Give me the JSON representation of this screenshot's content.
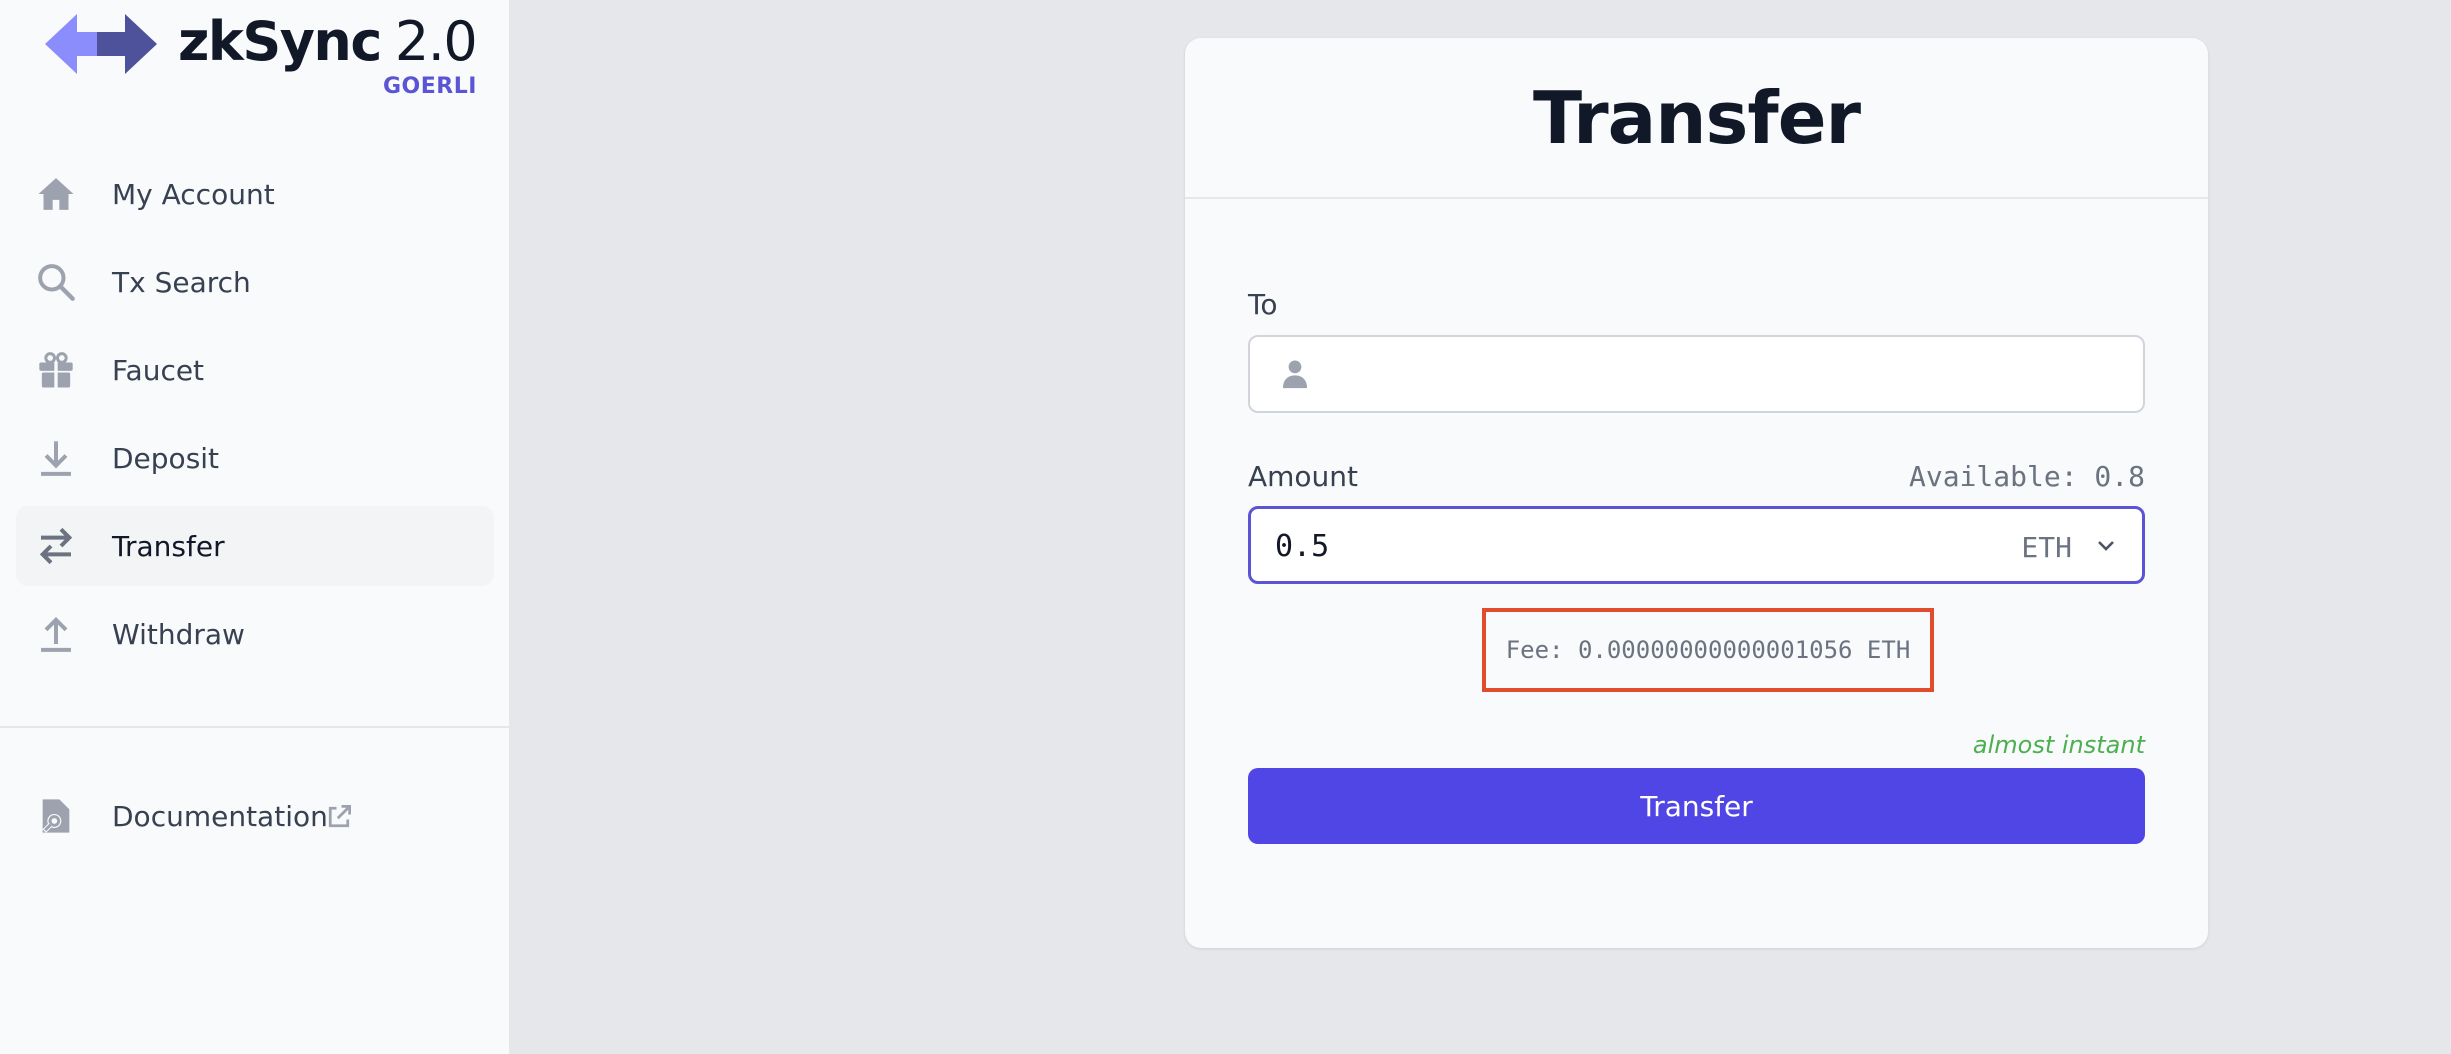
{
  "brand": {
    "name": "zkSync",
    "version": "2.0",
    "network": "GOERLI"
  },
  "sidebar": {
    "items": [
      {
        "label": "My Account",
        "icon": "home-icon"
      },
      {
        "label": "Tx Search",
        "icon": "search-icon"
      },
      {
        "label": "Faucet",
        "icon": "gift-icon"
      },
      {
        "label": "Deposit",
        "icon": "download-icon"
      },
      {
        "label": "Transfer",
        "icon": "transfer-icon",
        "active": true
      },
      {
        "label": "Withdraw",
        "icon": "upload-icon"
      }
    ],
    "documentation": {
      "label": "Documentation",
      "icon": "document-search-icon",
      "ext_icon": "external-link-icon"
    }
  },
  "transfer": {
    "title": "Transfer",
    "to_label": "To",
    "to_value": "",
    "amount_label": "Amount",
    "available": "Available: 0.8",
    "amount_value": "0.5",
    "token": "ETH",
    "fee": "Fee: 0.00000000000001056 ETH",
    "speed": "almost instant",
    "submit_label": "Transfer"
  },
  "colors": {
    "accent": "#4f46e5",
    "focus_border": "#5b55d6",
    "highlight_box": "#e14b2e",
    "speed_text": "#4caf50"
  }
}
